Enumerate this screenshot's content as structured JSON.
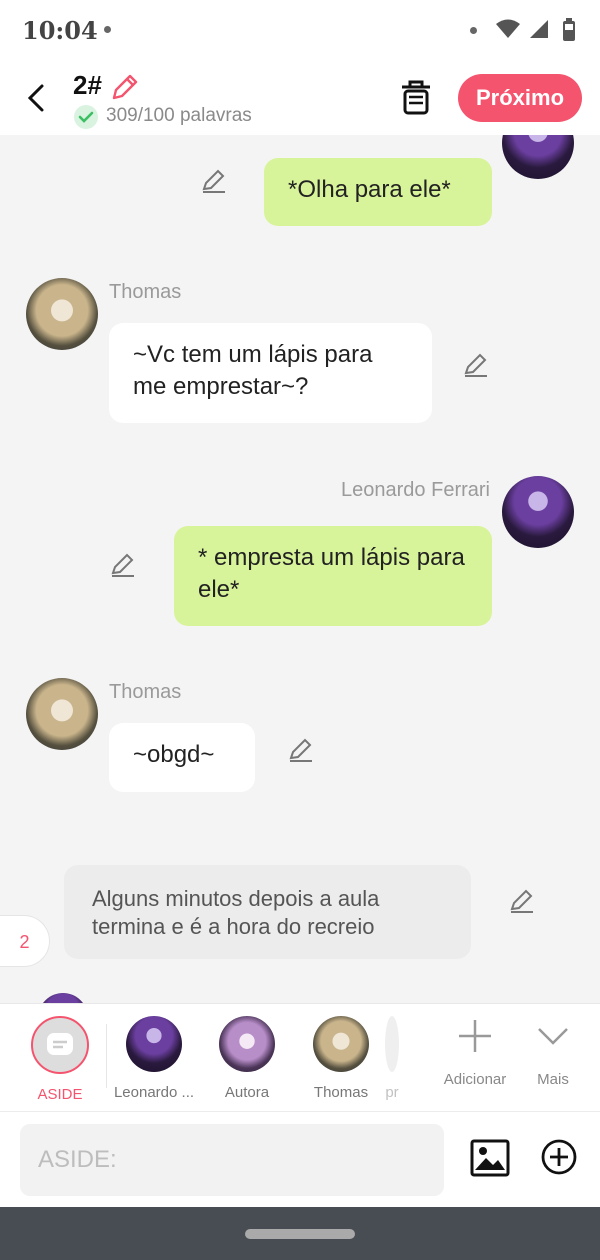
{
  "status_bar": {
    "time": "10:04"
  },
  "header": {
    "title": "2#",
    "word_count": "309/100 palavras",
    "next_label": "Próximo"
  },
  "messages": [
    {
      "sender": "",
      "text": "*Olha para ele*",
      "side": "right"
    },
    {
      "sender": "Thomas",
      "text": "~Vc tem um lápis para me emprestar~?",
      "side": "left"
    },
    {
      "sender": "Leonardo Ferrari",
      "text": "* empresta um lápis para ele*",
      "side": "right"
    },
    {
      "sender": "Thomas",
      "text": "~obgd~",
      "side": "left"
    },
    {
      "sender": "",
      "text": "Alguns minutos depois a aula termina e é a hora do recreio",
      "side": "aside"
    }
  ],
  "side_counter": "2",
  "characters": [
    {
      "label": "ASIDE"
    },
    {
      "label": "Leonardo ..."
    },
    {
      "label": "Autora"
    },
    {
      "label": "Thomas"
    },
    {
      "label": "pr"
    }
  ],
  "tools": {
    "add_label": "Adicionar",
    "more_label": "Mais"
  },
  "input": {
    "placeholder": "ASIDE:"
  },
  "colors": {
    "accent": "#f4546e",
    "green_bubble": "#d8f49a",
    "white_bubble": "#ffffff"
  }
}
